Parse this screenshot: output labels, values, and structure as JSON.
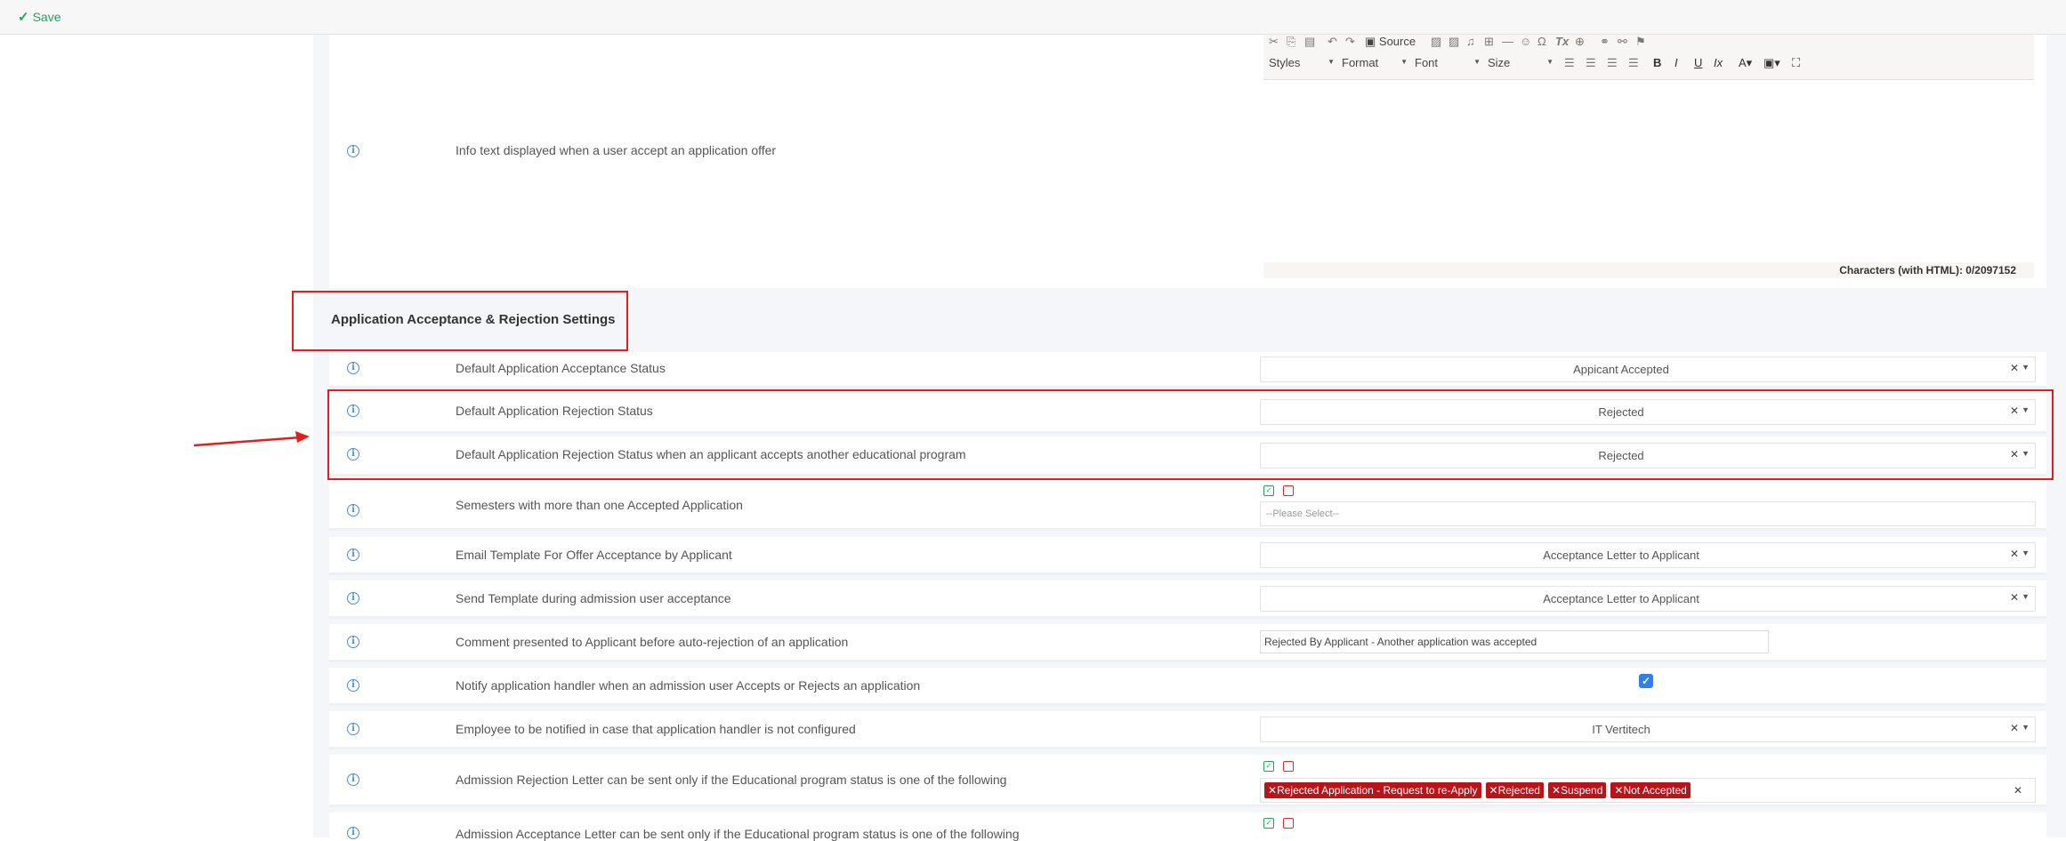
{
  "toolbar": {
    "save_label": "Save"
  },
  "editor": {
    "source_label": "Source",
    "styles_label": "Styles",
    "format_label": "Format",
    "font_label": "Font",
    "size_label": "Size",
    "chars_label": "Characters (with HTML): 0/2097152"
  },
  "info_row": {
    "label": "Info text displayed when a user accept an application offer"
  },
  "section": {
    "title": "Application Acceptance & Rejection Settings"
  },
  "rows": [
    {
      "label": "Default Application Acceptance Status",
      "value": "Appicant Accepted"
    },
    {
      "label": "Default Application Rejection Status",
      "value": "Rejected"
    },
    {
      "label": "Default Application Rejection Status when an applicant accepts another educational program",
      "value": "Rejected"
    },
    {
      "label": "Semesters with more than one Accepted Application",
      "placeholder": "--Please Select--"
    },
    {
      "label": "Email Template For Offer Acceptance by Applicant",
      "value": "Acceptance Letter to Applicant"
    },
    {
      "label": "Send Template during admission user acceptance",
      "value": "Acceptance Letter to Applicant"
    },
    {
      "label": "Comment presented to Applicant before auto-rejection of an application",
      "value": "Rejected By Applicant - Another application was accepted"
    },
    {
      "label": "Notify application handler when an admission user Accepts or Rejects an application"
    },
    {
      "label": "Employee to be notified in case that application handler is not configured",
      "value": "IT Vertitech"
    },
    {
      "label": "Admission Rejection Letter can be sent only if the Educational program status is one of the following",
      "tags": [
        "Rejected Application - Request to re-Apply",
        "Rejected",
        "Suspend",
        "Not Accepted"
      ]
    },
    {
      "label": "Admission Acceptance Letter can be sent only if the Educational program status is one of the following"
    }
  ],
  "colors": {
    "accent_green": "#26a35a",
    "highlight_red": "#e02020",
    "tag_red": "#b5151b",
    "info_blue": "#4a8ed1"
  }
}
